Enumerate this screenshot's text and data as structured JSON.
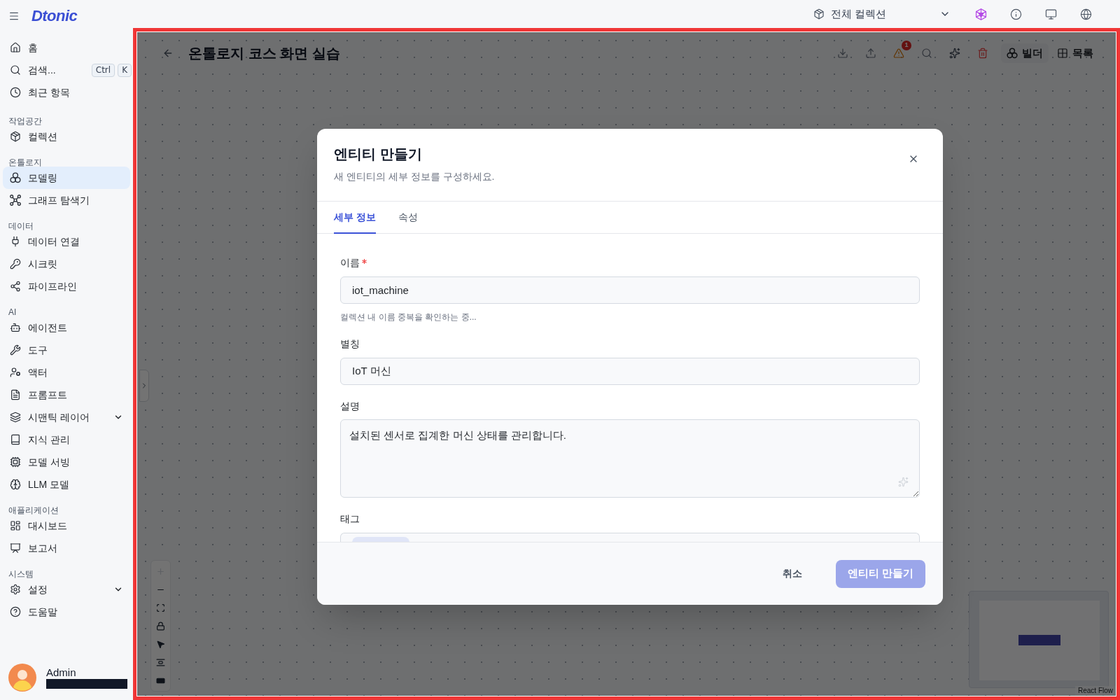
{
  "sidebar": {
    "logo": "Dtonic",
    "sections": [
      {
        "items": [
          {
            "label": "홈",
            "kind": "link",
            "selected": false
          },
          {
            "label": "검색...",
            "kind": "link",
            "selected": false,
            "shortcut": [
              "Ctrl",
              "K"
            ]
          },
          {
            "label": "최근 항목",
            "kind": "link",
            "selected": false
          }
        ]
      },
      {
        "title": "작업공간",
        "items": [
          {
            "label": "컬렉션",
            "kind": "link",
            "selected": false
          }
        ]
      },
      {
        "title": "온톨로지",
        "items": [
          {
            "label": "모델링",
            "kind": "link",
            "selected": true
          },
          {
            "label": "그래프 탐색기",
            "kind": "link",
            "selected": false
          }
        ]
      },
      {
        "title": "데이터",
        "items": [
          {
            "label": "데이터 연결",
            "kind": "link",
            "selected": false
          },
          {
            "label": "시크릿",
            "kind": "link",
            "selected": false
          },
          {
            "label": "파이프라인",
            "kind": "link",
            "selected": false
          }
        ]
      },
      {
        "title": "AI",
        "items": [
          {
            "label": "에이전트",
            "kind": "link",
            "selected": false
          },
          {
            "label": "도구",
            "kind": "link",
            "selected": false
          },
          {
            "label": "액터",
            "kind": "link",
            "selected": false
          },
          {
            "label": "프롬프트",
            "kind": "link",
            "selected": false
          },
          {
            "label": "시맨틱 레이어",
            "kind": "group",
            "selected": false
          },
          {
            "label": "지식 관리",
            "kind": "link",
            "selected": false
          },
          {
            "label": "모델 서빙",
            "kind": "link",
            "selected": false
          },
          {
            "label": "LLM 모델",
            "kind": "link",
            "selected": false
          }
        ]
      },
      {
        "title": "애플리케이션",
        "items": [
          {
            "label": "대시보드",
            "kind": "link",
            "selected": false
          },
          {
            "label": "보고서",
            "kind": "link",
            "selected": false
          }
        ]
      },
      {
        "title": "시스템",
        "items": [
          {
            "label": "설정",
            "kind": "group",
            "selected": false
          },
          {
            "label": "도움말",
            "kind": "link",
            "selected": false
          }
        ]
      }
    ],
    "user": {
      "name": "Admin"
    }
  },
  "topbar": {
    "collection": "전체 컬렉션"
  },
  "canvas": {
    "title": "온톨로지 코스 화면 실습",
    "warning_count": "1",
    "views": [
      {
        "label": "빌더",
        "selected": true
      },
      {
        "label": "목록",
        "selected": false
      }
    ],
    "controls": [
      {
        "kind": "zoom_in",
        "disabled": true
      },
      {
        "kind": "zoom_out",
        "disabled": false
      },
      {
        "kind": "fit_view",
        "disabled": false
      },
      {
        "kind": "lock",
        "disabled": false
      },
      {
        "kind": "select",
        "disabled": false
      },
      {
        "kind": "align",
        "disabled": false
      },
      {
        "kind": "minimap",
        "disabled": false
      }
    ],
    "attribution": "React Flow"
  },
  "dialog": {
    "title": "엔티티 만들기",
    "subtitle": "새 엔티티의 세부 정보를 구성하세요.",
    "tabs": [
      {
        "label": "세부 정보",
        "selected": true
      },
      {
        "label": "속성",
        "selected": false
      }
    ],
    "fields": [
      {
        "kind": "input",
        "label": "이름",
        "required": true,
        "value": "iot_machine",
        "helper_text": "컬렉션 내 이름 중복을 확인하는 중..."
      },
      {
        "kind": "input",
        "label": "별칭",
        "required": false,
        "value": "IoT 머신"
      },
      {
        "kind": "textarea",
        "label": "설명",
        "required": false,
        "value": "설치된 센서로 집계한 머신 상태를 관리합니다."
      },
      {
        "kind": "tags",
        "label": "태그",
        "required": false
      }
    ],
    "buttons": [
      {
        "kind": "secondary",
        "label": "취소",
        "disabled": false
      },
      {
        "kind": "primary",
        "label": "엔티티 만들기",
        "disabled": true
      }
    ]
  }
}
